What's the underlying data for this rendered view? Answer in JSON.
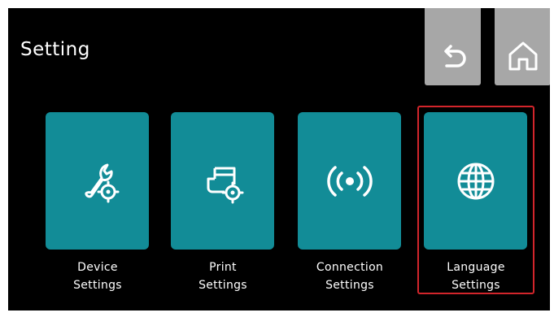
{
  "header": {
    "title": "Setting"
  },
  "buttons": {
    "back_icon": "undo-arrow",
    "home_icon": "house"
  },
  "tiles": [
    {
      "label_line1": "Device",
      "label_line2": "Settings",
      "icon": "wrench-gear"
    },
    {
      "label_line1": "Print",
      "label_line2": "Settings",
      "icon": "printer-gear"
    },
    {
      "label_line1": "Connection",
      "label_line2": "Settings",
      "icon": "broadcast-signal"
    },
    {
      "label_line1": "Language",
      "label_line2": "Settings",
      "icon": "globe"
    }
  ],
  "selected_tile": "Language Settings",
  "colors": {
    "background": "#000000",
    "tile": "#128c97",
    "top_button": "#a7a7a7",
    "highlight": "#d2252b",
    "text": "#ffffff"
  }
}
